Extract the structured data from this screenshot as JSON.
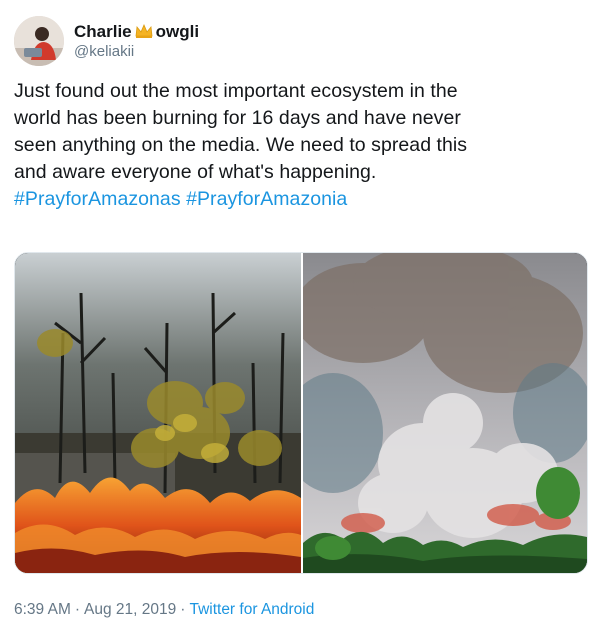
{
  "user": {
    "display_name_prefix": "Charlie",
    "display_name_emoji": "crown-emoji",
    "display_name_suffix": "owgli",
    "handle": "@keliakii"
  },
  "tweet": {
    "lines": [
      "Just found out the most important ecosystem in the",
      "world has been burning for 16 days and have never",
      "seen anything on the media. We need to spread this",
      "and aware everyone of what's happening."
    ],
    "hashtags": [
      "#PrayforAmazonas",
      "#PrayforAmazonia"
    ]
  },
  "media": {
    "images": [
      "burnt-forest-with-fire-photo",
      "forest-fire-smoke-photo"
    ]
  },
  "meta": {
    "time": "6:39 AM",
    "separator": "·",
    "date": "Aug 21, 2019",
    "source": "Twitter for Android"
  },
  "colors": {
    "link": "#1b95e0",
    "secondary_text": "#657786",
    "primary_text": "#14171a"
  }
}
